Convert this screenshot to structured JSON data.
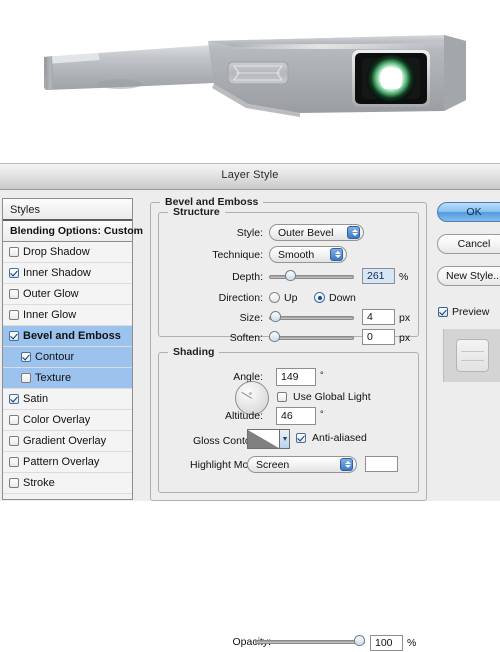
{
  "render": {
    "alt_name": "metallic-device-3d-render",
    "background": "#ffffff",
    "body_color": "#b9bcc0",
    "lens_color": "#101010",
    "lens_glow": "#eafff0"
  },
  "dialog": {
    "title": "Layer Style",
    "styles_header": "Styles",
    "blending_options": "Blending Options: Custom",
    "style_items": [
      {
        "label": "Drop Shadow",
        "checked": false,
        "selected": false,
        "sub": false
      },
      {
        "label": "Inner Shadow",
        "checked": true,
        "selected": false,
        "sub": false
      },
      {
        "label": "Outer Glow",
        "checked": false,
        "selected": false,
        "sub": false
      },
      {
        "label": "Inner Glow",
        "checked": false,
        "selected": false,
        "sub": false
      },
      {
        "label": "Bevel and Emboss",
        "checked": true,
        "selected": true,
        "sub": false
      },
      {
        "label": "Contour",
        "checked": true,
        "selected": true,
        "sub": true
      },
      {
        "label": "Texture",
        "checked": false,
        "selected": true,
        "sub": true
      },
      {
        "label": "Satin",
        "checked": true,
        "selected": false,
        "sub": false
      },
      {
        "label": "Color Overlay",
        "checked": false,
        "selected": false,
        "sub": false
      },
      {
        "label": "Gradient Overlay",
        "checked": false,
        "selected": false,
        "sub": false
      },
      {
        "label": "Pattern Overlay",
        "checked": false,
        "selected": false,
        "sub": false
      },
      {
        "label": "Stroke",
        "checked": false,
        "selected": false,
        "sub": false
      }
    ],
    "panel": {
      "group_title": "Bevel and Emboss",
      "structure": {
        "legend": "Structure",
        "style_label": "Style:",
        "style_value": "Outer Bevel",
        "technique_label": "Technique:",
        "technique_value": "Smooth",
        "depth_label": "Depth:",
        "depth_value": "261",
        "depth_unit": "%",
        "depth_percent": 22,
        "direction_label": "Direction:",
        "direction_up": "Up",
        "direction_down": "Down",
        "direction_selected": "Down",
        "size_label": "Size:",
        "size_value": "4",
        "size_unit": "px",
        "size_percent": 4,
        "soften_label": "Soften:",
        "soften_value": "0",
        "soften_unit": "px",
        "soften_percent": 1
      },
      "shading": {
        "legend": "Shading",
        "angle_label": "Angle:",
        "angle_value": "149",
        "angle_unit": "°",
        "use_global_light": "Use Global Light",
        "use_global_light_checked": false,
        "altitude_label": "Altitude:",
        "altitude_value": "46",
        "altitude_unit": "°",
        "gloss_contour_label": "Gloss Contour:",
        "anti_aliased": "Anti-aliased",
        "anti_aliased_checked": true,
        "highlight_mode_label": "Highlight Mode:",
        "highlight_mode_value": "Screen",
        "highlight_color": "#ffffff",
        "opacity_label": "Opacity:",
        "opacity_value": "100",
        "opacity_unit": "%",
        "opacity_percent": 100
      }
    },
    "buttons": {
      "ok": "OK",
      "cancel": "Cancel",
      "new_style": "New Style...",
      "preview": "Preview",
      "preview_checked": true
    },
    "colors": {
      "accent_blue": "#4f9ae0",
      "selection_blue": "#9cc3ee",
      "dialog_bg": "#ededed",
      "field_highlight": "#d7e6f7"
    }
  }
}
